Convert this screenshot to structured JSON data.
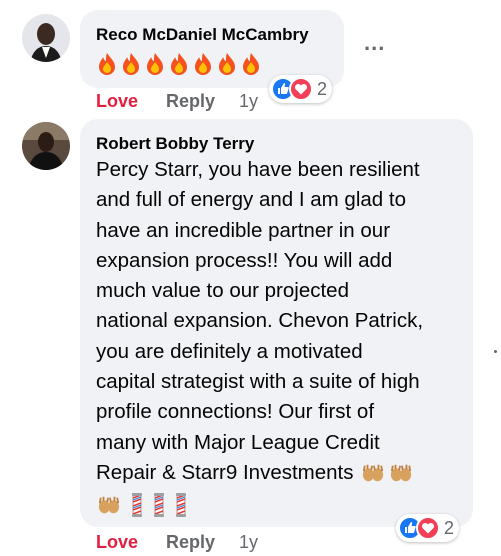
{
  "comments": [
    {
      "author": "Reco McDaniel McCambry",
      "emoji_icons": [
        "fire-icon",
        "fire-icon",
        "fire-icon",
        "fire-icon",
        "fire-icon",
        "fire-icon",
        "fire-icon"
      ],
      "actions": {
        "love": "Love",
        "reply": "Reply",
        "time": "1y"
      },
      "reactions": {
        "icons": [
          "like-icon",
          "love-icon"
        ],
        "count": "2"
      },
      "more_label": "..."
    },
    {
      "author": "Robert Bobby Terry",
      "text_lines": [
        "Percy Starr, you have been resilient",
        "and full of energy and I am glad to",
        "have an incredible partner in our",
        "expansion process!! You will add",
        "much value to our projected",
        "national expansion. Chevon Patrick,",
        "you are definitely a motivated",
        "capital strategist with a suite of high",
        "profile connections! Our first of",
        "many with Major League Credit",
        "Repair & Starr9 Investments"
      ],
      "emoji_icons": [
        "raised-hands-icon",
        "raised-hands-icon",
        "raised-hands-icon",
        "barber-pole-icon",
        "barber-pole-icon",
        "barber-pole-icon"
      ],
      "actions": {
        "love": "Love",
        "reply": "Reply",
        "time": "1y"
      },
      "reactions": {
        "icons": [
          "like-icon",
          "love-icon"
        ],
        "count": "2"
      }
    }
  ],
  "colors": {
    "bubble": "#f0f2f5",
    "love": "#e41e3f",
    "like": "#1877f2",
    "secondary": "#65676b"
  }
}
